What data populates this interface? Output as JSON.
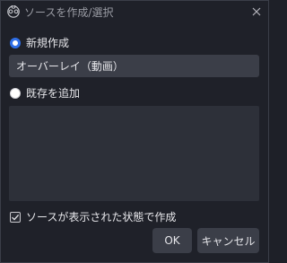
{
  "window": {
    "title": "ソースを作成/選択"
  },
  "options": {
    "create_new_label": "新規作成",
    "create_new_selected": true,
    "add_existing_label": "既存を追加",
    "add_existing_selected": false
  },
  "name_field": {
    "value": "オーバーレイ（動画）"
  },
  "existing_sources": {
    "items": []
  },
  "visibility_checkbox": {
    "label": "ソースが表示された状態で作成",
    "checked": true
  },
  "buttons": {
    "ok_label": "OK",
    "cancel_label": "キャンセル"
  },
  "colors": {
    "background": "#1f2129",
    "input_background": "#3b3e48",
    "list_background": "#2d3039",
    "accent": "#2f6fe8",
    "text": "#e6e6ea"
  },
  "icons": {
    "app": "obs-logo-icon",
    "close": "close-icon"
  }
}
